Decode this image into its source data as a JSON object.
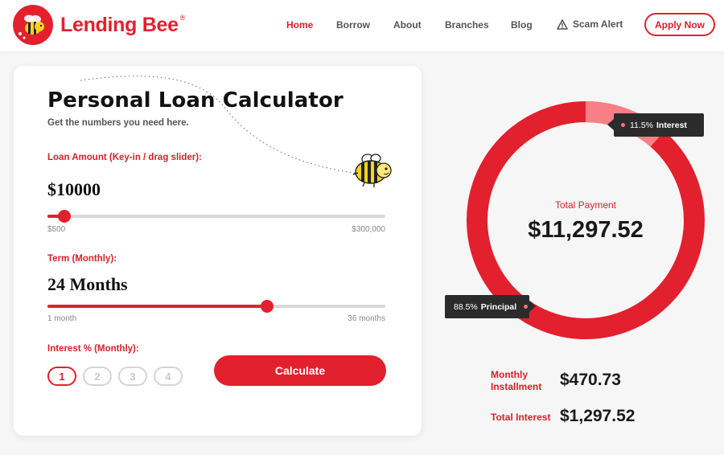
{
  "brand": {
    "name": "Lending Bee",
    "registered_mark": "®",
    "colors": {
      "primary": "#e3202e",
      "interest_slice": "#f97f86",
      "tooltip_bg": "#2b2b2b"
    }
  },
  "nav": {
    "items": [
      {
        "label": "Home",
        "active": true
      },
      {
        "label": "Borrow",
        "active": false
      },
      {
        "label": "About",
        "active": false
      },
      {
        "label": "Branches",
        "active": false
      },
      {
        "label": "Blog",
        "active": false
      }
    ],
    "scam_alert": {
      "label": "Scam Alert",
      "icon": "warning-icon"
    },
    "apply_label": "Apply Now"
  },
  "calculator": {
    "title": "Personal Loan Calculator",
    "subtitle": "Get the numbers you need here.",
    "loan_amount": {
      "label": "Loan Amount (Key-in / drag slider):",
      "value": "$10000",
      "min_label": "$500",
      "max_label": "$300,000",
      "slider_fraction": 0.05
    },
    "term": {
      "label": "Term (Monthly):",
      "value": "24 Months",
      "min_label": "1 month",
      "max_label": "36 months",
      "slider_fraction": 0.65
    },
    "interest": {
      "label": "Interest % (Monthly):",
      "options": [
        "1",
        "2",
        "3",
        "4"
      ],
      "selected": "1"
    },
    "calculate_label": "Calculate"
  },
  "results": {
    "total_payment_label": "Total Payment",
    "total_payment": "$11,297.52",
    "monthly_installment_label": "Monthly Installment",
    "monthly_installment": "$470.73",
    "total_interest_label": "Total Interest",
    "total_interest": "$1,297.52",
    "breakdown": {
      "interest_percent": "11.5%",
      "interest_label": "Interest",
      "principal_percent": "88.5%",
      "principal_label": "Principal",
      "interest_fraction": 0.115
    }
  }
}
